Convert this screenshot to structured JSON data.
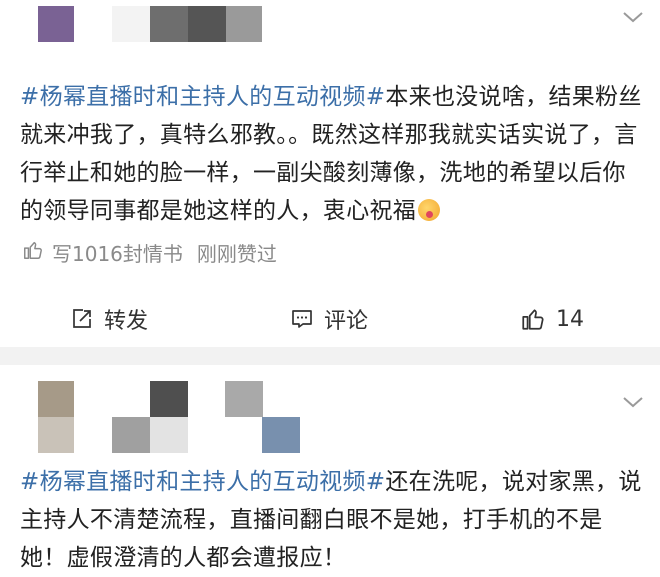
{
  "post1": {
    "topic": "#杨幂直播时和主持人的互动视频#",
    "body": "本来也没说啥，结果粉丝就来冲我了，真特么邪教。。既然这样那我就实话实说了，言行举止和她的脸一样，一副尖酸刻薄像，洗地的希望以后你的领导同事都是她这样的人，衷心祝福",
    "emoji": "smiling-face-emoji",
    "like_info": {
      "text": "写1016封情书",
      "status": "刚刚赞过"
    },
    "actions": {
      "repost_label": "转发",
      "comment_label": "评论",
      "like_count": "14"
    }
  },
  "post2": {
    "topic": "#杨幂直播时和主持人的互动视频#",
    "body": "还在洗呢，说对家黑，说主持人不清楚流程，直播间翻白眼不是她，打手机的不是她！虚假澄清的人都会遭报应！"
  },
  "colors": {
    "topic_link": "#3c6fa8",
    "separator": "#f2f2f2",
    "muted_text": "#8a8a8a"
  },
  "icons": [
    "chevron-down-icon",
    "thumbs-up-icon",
    "share-icon",
    "comment-icon"
  ]
}
